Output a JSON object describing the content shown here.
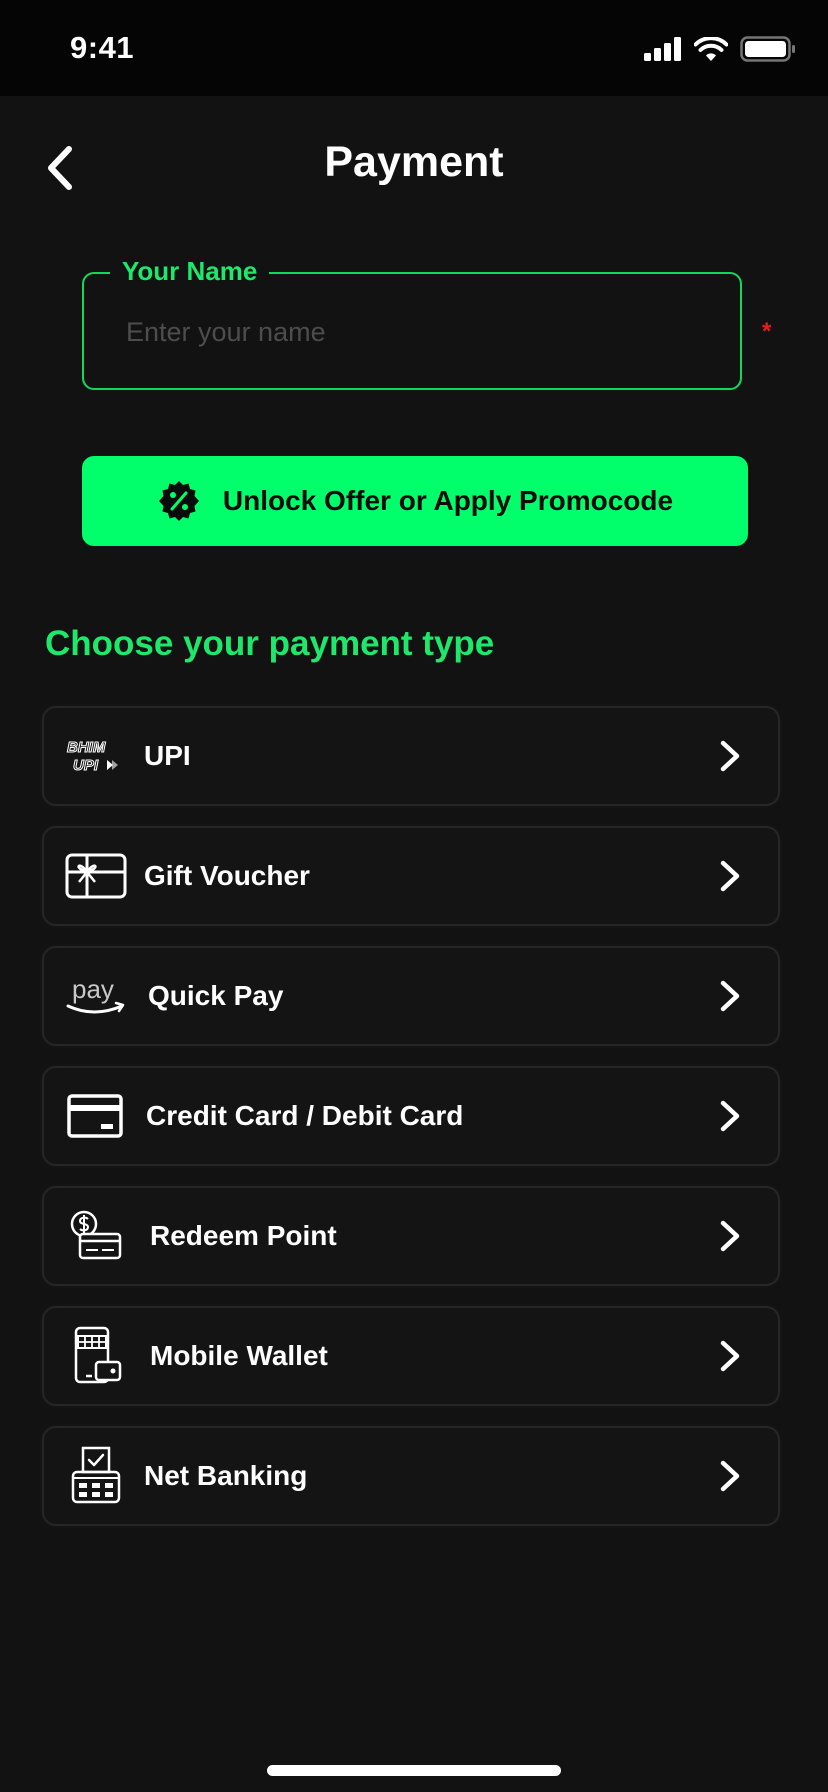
{
  "status_bar": {
    "time": "9:41"
  },
  "header": {
    "title": "Payment"
  },
  "name_field": {
    "label": "Your Name",
    "placeholder": "Enter your name",
    "value": "",
    "required_marker": "*"
  },
  "promo_button": {
    "label": "Unlock Offer or Apply Promocode"
  },
  "payment_section": {
    "title": "Choose your payment type",
    "items": [
      {
        "label": "UPI",
        "icon": "bhim-upi-icon"
      },
      {
        "label": "Gift Voucher",
        "icon": "gift-voucher-icon"
      },
      {
        "label": "Quick Pay",
        "icon": "pay-icon"
      },
      {
        "label": "Credit Card / Debit Card",
        "icon": "credit-card-icon"
      },
      {
        "label": "Redeem Point",
        "icon": "redeem-point-icon"
      },
      {
        "label": "Mobile Wallet",
        "icon": "mobile-wallet-icon"
      },
      {
        "label": "Net Banking",
        "icon": "net-banking-icon"
      }
    ]
  },
  "icon_logo_text": {
    "bhim": "BHIM",
    "upi": "UPI",
    "pay": "pay"
  },
  "colors": {
    "background": "#121212",
    "accent": "#00ff6a",
    "accent_text": "#1ee86c",
    "required": "#e02020"
  }
}
